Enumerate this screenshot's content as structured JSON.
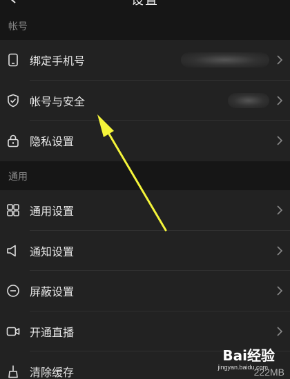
{
  "header": {
    "title": "设置"
  },
  "sections": {
    "account": {
      "label": "帐号",
      "items": [
        {
          "label": "绑定手机号",
          "icon": "phone-icon"
        },
        {
          "label": "帐号与安全",
          "icon": "shield-icon"
        },
        {
          "label": "隐私设置",
          "icon": "lock-icon"
        }
      ]
    },
    "general": {
      "label": "通用",
      "items": [
        {
          "label": "通用设置",
          "icon": "grid-icon"
        },
        {
          "label": "通知设置",
          "icon": "speaker-icon"
        },
        {
          "label": "屏蔽设置",
          "icon": "block-icon"
        },
        {
          "label": "开通直播",
          "icon": "camera-icon"
        },
        {
          "label": "清除缓存",
          "icon": "broom-icon"
        }
      ]
    }
  },
  "cache_size": "222MB",
  "watermark": {
    "logo": "Bai经验",
    "url": "jingyan.baidu.com"
  },
  "colors": {
    "background": "#161616",
    "row": "#222222",
    "annotation_arrow": "#f5f53a"
  }
}
